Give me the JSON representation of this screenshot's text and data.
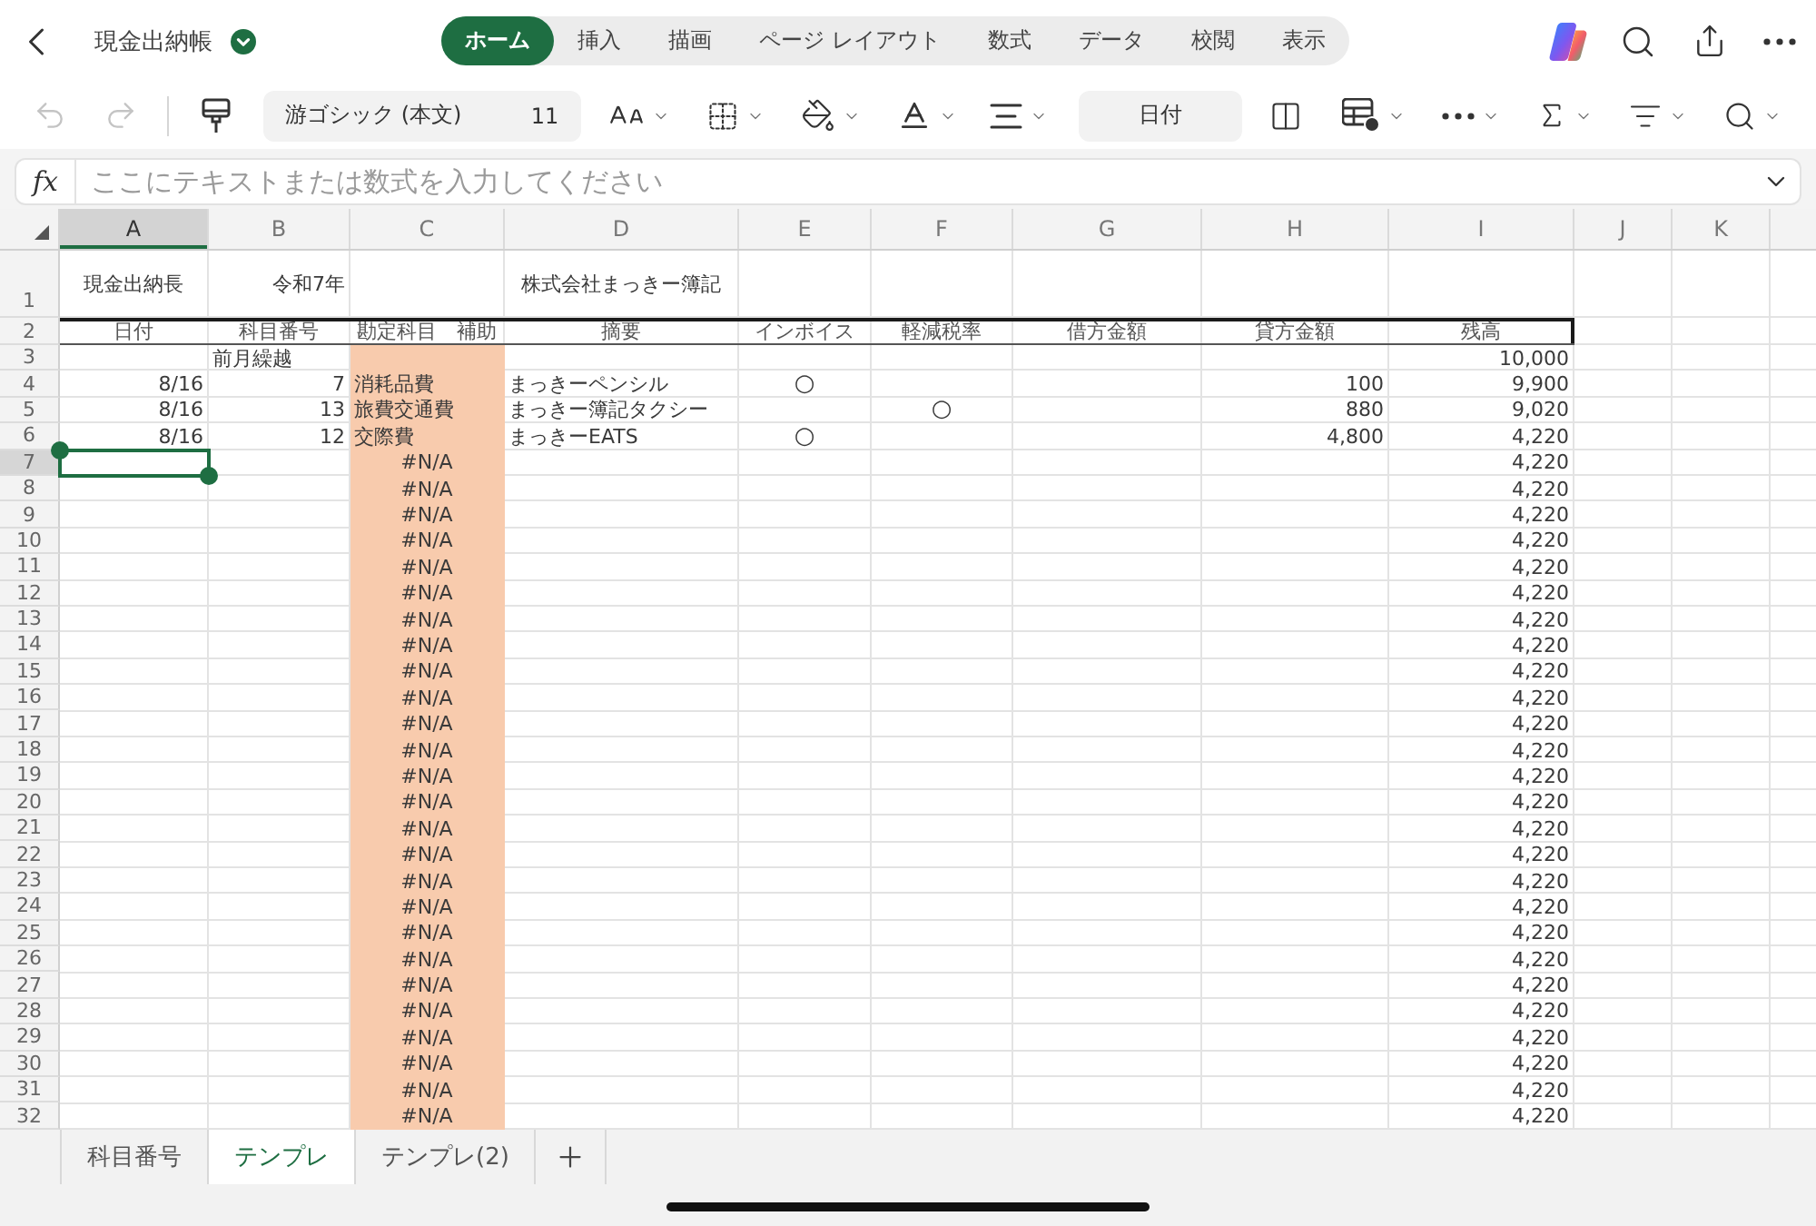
{
  "app_bar": {
    "title": "現金出納帳",
    "tabs": [
      {
        "label": "ホーム",
        "selected": true
      },
      {
        "label": "挿入",
        "selected": false
      },
      {
        "label": "描画",
        "selected": false
      },
      {
        "label": "ページ レイアウト",
        "selected": false
      },
      {
        "label": "数式",
        "selected": false
      },
      {
        "label": "データ",
        "selected": false
      },
      {
        "label": "校閲",
        "selected": false
      },
      {
        "label": "表示",
        "selected": false
      }
    ]
  },
  "toolbar": {
    "history": [
      {
        "kind": "undo",
        "disabled": true
      },
      {
        "kind": "redo",
        "disabled": true
      }
    ],
    "font_name": "游ゴシック (本文)",
    "font_size": "11",
    "number_format": "日付"
  },
  "formula_bar": {
    "label": "fx",
    "placeholder": "ここにテキストまたは数式を入力してください"
  },
  "sheet": {
    "columns": [
      {
        "label": "A",
        "selected": true
      },
      {
        "label": "B",
        "selected": false
      },
      {
        "label": "C",
        "selected": false
      },
      {
        "label": "D",
        "selected": false
      },
      {
        "label": "E",
        "selected": false
      },
      {
        "label": "F",
        "selected": false
      },
      {
        "label": "G",
        "selected": false
      },
      {
        "label": "H",
        "selected": false
      },
      {
        "label": "I",
        "selected": false
      },
      {
        "label": "J",
        "selected": false
      },
      {
        "label": "K",
        "selected": false
      }
    ],
    "rows": [
      {
        "number": "1",
        "kind": "title",
        "selected": false,
        "cells": [
          {
            "text": "現金出納長",
            "kind": "label"
          },
          {
            "text": "令和7年",
            "kind": "date"
          },
          {
            "kind": "blank"
          },
          {
            "text": "株式会社まっきー簿記",
            "kind": "label"
          }
        ]
      },
      {
        "number": "2",
        "kind": "header",
        "selected": false,
        "cells": [
          {
            "text": "日付",
            "kind": "label"
          },
          {
            "text": "科目番号",
            "kind": "label"
          },
          {
            "text": "勘定科目　補助",
            "kind": "label"
          },
          {
            "text": "摘要",
            "kind": "label"
          },
          {
            "text": "インボイス",
            "kind": "label"
          },
          {
            "text": "軽減税率",
            "kind": "label"
          },
          {
            "text": "借方金額",
            "kind": "label"
          },
          {
            "text": "貸方金額",
            "kind": "label"
          },
          {
            "text": "残高",
            "kind": "label"
          }
        ]
      },
      {
        "number": "3",
        "kind": "data",
        "selected": false,
        "cells": [
          {
            "kind": "blank"
          },
          {
            "text": "前月繰越",
            "kind": "text"
          },
          {
            "kind": "blank",
            "color": "#f8cbad"
          },
          {
            "kind": "blank"
          },
          {
            "kind": "blank"
          },
          {
            "kind": "blank"
          },
          {
            "kind": "blank"
          },
          {
            "kind": "blank"
          },
          {
            "text": "10,000",
            "kind": "number"
          }
        ]
      },
      {
        "number": "4",
        "kind": "data",
        "selected": false,
        "cells": [
          {
            "text": "8/16",
            "kind": "date"
          },
          {
            "text": "7",
            "kind": "number"
          },
          {
            "text": "消耗品費",
            "kind": "text",
            "color": "#f8cbad"
          },
          {
            "text": "まっきーペンシル",
            "kind": "text"
          },
          {
            "text": "○",
            "kind": "mark"
          },
          {
            "kind": "blank"
          },
          {
            "kind": "blank"
          },
          {
            "text": "100",
            "kind": "number"
          },
          {
            "text": "9,900",
            "kind": "number"
          }
        ]
      },
      {
        "number": "5",
        "kind": "data",
        "selected": false,
        "cells": [
          {
            "text": "8/16",
            "kind": "date"
          },
          {
            "text": "13",
            "kind": "number"
          },
          {
            "text": "旅費交通費",
            "kind": "text",
            "color": "#f8cbad"
          },
          {
            "text": "まっきー簿記タクシー",
            "kind": "text"
          },
          {
            "kind": "blank"
          },
          {
            "text": "○",
            "kind": "mark"
          },
          {
            "kind": "blank"
          },
          {
            "text": "880",
            "kind": "number"
          },
          {
            "text": "9,020",
            "kind": "number"
          }
        ]
      },
      {
        "number": "6",
        "kind": "data",
        "selected": false,
        "cells": [
          {
            "text": "8/16",
            "kind": "date"
          },
          {
            "text": "12",
            "kind": "number"
          },
          {
            "text": "交際費",
            "kind": "text",
            "color": "#f8cbad"
          },
          {
            "text": "まっきーEATS",
            "kind": "text"
          },
          {
            "text": "○",
            "kind": "mark"
          },
          {
            "kind": "blank"
          },
          {
            "kind": "blank"
          },
          {
            "text": "4,800",
            "kind": "number"
          },
          {
            "text": "4,220",
            "kind": "number"
          }
        ]
      },
      {
        "number": "7",
        "kind": "data",
        "selected": true,
        "cells": [
          {
            "kind": "blank"
          },
          {
            "kind": "blank"
          },
          {
            "text": "#N/A",
            "kind": "error",
            "color": "#f8cbad"
          },
          {
            "kind": "blank"
          },
          {
            "kind": "blank"
          },
          {
            "kind": "blank"
          },
          {
            "kind": "blank"
          },
          {
            "kind": "blank"
          },
          {
            "text": "4,220",
            "kind": "number"
          }
        ]
      },
      {
        "number": "8",
        "kind": "data",
        "selected": false,
        "cells": [
          {
            "kind": "blank"
          },
          {
            "kind": "blank"
          },
          {
            "text": "#N/A",
            "kind": "error",
            "color": "#f8cbad"
          },
          {
            "kind": "blank"
          },
          {
            "kind": "blank"
          },
          {
            "kind": "blank"
          },
          {
            "kind": "blank"
          },
          {
            "kind": "blank"
          },
          {
            "text": "4,220",
            "kind": "number"
          }
        ]
      },
      {
        "number": "9",
        "kind": "data",
        "selected": false,
        "cells": [
          {
            "kind": "blank"
          },
          {
            "kind": "blank"
          },
          {
            "text": "#N/A",
            "kind": "error",
            "color": "#f8cbad"
          },
          {
            "kind": "blank"
          },
          {
            "kind": "blank"
          },
          {
            "kind": "blank"
          },
          {
            "kind": "blank"
          },
          {
            "kind": "blank"
          },
          {
            "text": "4,220",
            "kind": "number"
          }
        ]
      },
      {
        "number": "10",
        "kind": "data",
        "selected": false,
        "cells": [
          {
            "kind": "blank"
          },
          {
            "kind": "blank"
          },
          {
            "text": "#N/A",
            "kind": "error",
            "color": "#f8cbad"
          },
          {
            "kind": "blank"
          },
          {
            "kind": "blank"
          },
          {
            "kind": "blank"
          },
          {
            "kind": "blank"
          },
          {
            "kind": "blank"
          },
          {
            "text": "4,220",
            "kind": "number"
          }
        ]
      },
      {
        "number": "11",
        "kind": "data",
        "selected": false,
        "cells": [
          {
            "kind": "blank"
          },
          {
            "kind": "blank"
          },
          {
            "text": "#N/A",
            "kind": "error",
            "color": "#f8cbad"
          },
          {
            "kind": "blank"
          },
          {
            "kind": "blank"
          },
          {
            "kind": "blank"
          },
          {
            "kind": "blank"
          },
          {
            "kind": "blank"
          },
          {
            "text": "4,220",
            "kind": "number"
          }
        ]
      },
      {
        "number": "12",
        "kind": "data",
        "selected": false,
        "cells": [
          {
            "kind": "blank"
          },
          {
            "kind": "blank"
          },
          {
            "text": "#N/A",
            "kind": "error",
            "color": "#f8cbad"
          },
          {
            "kind": "blank"
          },
          {
            "kind": "blank"
          },
          {
            "kind": "blank"
          },
          {
            "kind": "blank"
          },
          {
            "kind": "blank"
          },
          {
            "text": "4,220",
            "kind": "number"
          }
        ]
      },
      {
        "number": "13",
        "kind": "data",
        "selected": false,
        "cells": [
          {
            "kind": "blank"
          },
          {
            "kind": "blank"
          },
          {
            "text": "#N/A",
            "kind": "error",
            "color": "#f8cbad"
          },
          {
            "kind": "blank"
          },
          {
            "kind": "blank"
          },
          {
            "kind": "blank"
          },
          {
            "kind": "blank"
          },
          {
            "kind": "blank"
          },
          {
            "text": "4,220",
            "kind": "number"
          }
        ]
      },
      {
        "number": "14",
        "kind": "data",
        "selected": false,
        "cells": [
          {
            "kind": "blank"
          },
          {
            "kind": "blank"
          },
          {
            "text": "#N/A",
            "kind": "error",
            "color": "#f8cbad"
          },
          {
            "kind": "blank"
          },
          {
            "kind": "blank"
          },
          {
            "kind": "blank"
          },
          {
            "kind": "blank"
          },
          {
            "kind": "blank"
          },
          {
            "text": "4,220",
            "kind": "number"
          }
        ]
      },
      {
        "number": "15",
        "kind": "data",
        "selected": false,
        "cells": [
          {
            "kind": "blank"
          },
          {
            "kind": "blank"
          },
          {
            "text": "#N/A",
            "kind": "error",
            "color": "#f8cbad"
          },
          {
            "kind": "blank"
          },
          {
            "kind": "blank"
          },
          {
            "kind": "blank"
          },
          {
            "kind": "blank"
          },
          {
            "kind": "blank"
          },
          {
            "text": "4,220",
            "kind": "number"
          }
        ]
      },
      {
        "number": "16",
        "kind": "data",
        "selected": false,
        "cells": [
          {
            "kind": "blank"
          },
          {
            "kind": "blank"
          },
          {
            "text": "#N/A",
            "kind": "error",
            "color": "#f8cbad"
          },
          {
            "kind": "blank"
          },
          {
            "kind": "blank"
          },
          {
            "kind": "blank"
          },
          {
            "kind": "blank"
          },
          {
            "kind": "blank"
          },
          {
            "text": "4,220",
            "kind": "number"
          }
        ]
      },
      {
        "number": "17",
        "kind": "data",
        "selected": false,
        "cells": [
          {
            "kind": "blank"
          },
          {
            "kind": "blank"
          },
          {
            "text": "#N/A",
            "kind": "error",
            "color": "#f8cbad"
          },
          {
            "kind": "blank"
          },
          {
            "kind": "blank"
          },
          {
            "kind": "blank"
          },
          {
            "kind": "blank"
          },
          {
            "kind": "blank"
          },
          {
            "text": "4,220",
            "kind": "number"
          }
        ]
      },
      {
        "number": "18",
        "kind": "data",
        "selected": false,
        "cells": [
          {
            "kind": "blank"
          },
          {
            "kind": "blank"
          },
          {
            "text": "#N/A",
            "kind": "error",
            "color": "#f8cbad"
          },
          {
            "kind": "blank"
          },
          {
            "kind": "blank"
          },
          {
            "kind": "blank"
          },
          {
            "kind": "blank"
          },
          {
            "kind": "blank"
          },
          {
            "text": "4,220",
            "kind": "number"
          }
        ]
      },
      {
        "number": "19",
        "kind": "data",
        "selected": false,
        "cells": [
          {
            "kind": "blank"
          },
          {
            "kind": "blank"
          },
          {
            "text": "#N/A",
            "kind": "error",
            "color": "#f8cbad"
          },
          {
            "kind": "blank"
          },
          {
            "kind": "blank"
          },
          {
            "kind": "blank"
          },
          {
            "kind": "blank"
          },
          {
            "kind": "blank"
          },
          {
            "text": "4,220",
            "kind": "number"
          }
        ]
      },
      {
        "number": "20",
        "kind": "data",
        "selected": false,
        "cells": [
          {
            "kind": "blank"
          },
          {
            "kind": "blank"
          },
          {
            "text": "#N/A",
            "kind": "error",
            "color": "#f8cbad"
          },
          {
            "kind": "blank"
          },
          {
            "kind": "blank"
          },
          {
            "kind": "blank"
          },
          {
            "kind": "blank"
          },
          {
            "kind": "blank"
          },
          {
            "text": "4,220",
            "kind": "number"
          }
        ]
      },
      {
        "number": "21",
        "kind": "data",
        "selected": false,
        "cells": [
          {
            "kind": "blank"
          },
          {
            "kind": "blank"
          },
          {
            "text": "#N/A",
            "kind": "error",
            "color": "#f8cbad"
          },
          {
            "kind": "blank"
          },
          {
            "kind": "blank"
          },
          {
            "kind": "blank"
          },
          {
            "kind": "blank"
          },
          {
            "kind": "blank"
          },
          {
            "text": "4,220",
            "kind": "number"
          }
        ]
      },
      {
        "number": "22",
        "kind": "data",
        "selected": false,
        "cells": [
          {
            "kind": "blank"
          },
          {
            "kind": "blank"
          },
          {
            "text": "#N/A",
            "kind": "error",
            "color": "#f8cbad"
          },
          {
            "kind": "blank"
          },
          {
            "kind": "blank"
          },
          {
            "kind": "blank"
          },
          {
            "kind": "blank"
          },
          {
            "kind": "blank"
          },
          {
            "text": "4,220",
            "kind": "number"
          }
        ]
      },
      {
        "number": "23",
        "kind": "data",
        "selected": false,
        "cells": [
          {
            "kind": "blank"
          },
          {
            "kind": "blank"
          },
          {
            "text": "#N/A",
            "kind": "error",
            "color": "#f8cbad"
          },
          {
            "kind": "blank"
          },
          {
            "kind": "blank"
          },
          {
            "kind": "blank"
          },
          {
            "kind": "blank"
          },
          {
            "kind": "blank"
          },
          {
            "text": "4,220",
            "kind": "number"
          }
        ]
      },
      {
        "number": "24",
        "kind": "data",
        "selected": false,
        "cells": [
          {
            "kind": "blank"
          },
          {
            "kind": "blank"
          },
          {
            "text": "#N/A",
            "kind": "error",
            "color": "#f8cbad"
          },
          {
            "kind": "blank"
          },
          {
            "kind": "blank"
          },
          {
            "kind": "blank"
          },
          {
            "kind": "blank"
          },
          {
            "kind": "blank"
          },
          {
            "text": "4,220",
            "kind": "number"
          }
        ]
      },
      {
        "number": "25",
        "kind": "data",
        "selected": false,
        "cells": [
          {
            "kind": "blank"
          },
          {
            "kind": "blank"
          },
          {
            "text": "#N/A",
            "kind": "error",
            "color": "#f8cbad"
          },
          {
            "kind": "blank"
          },
          {
            "kind": "blank"
          },
          {
            "kind": "blank"
          },
          {
            "kind": "blank"
          },
          {
            "kind": "blank"
          },
          {
            "text": "4,220",
            "kind": "number"
          }
        ]
      },
      {
        "number": "26",
        "kind": "data",
        "selected": false,
        "cells": [
          {
            "kind": "blank"
          },
          {
            "kind": "blank"
          },
          {
            "text": "#N/A",
            "kind": "error",
            "color": "#f8cbad"
          },
          {
            "kind": "blank"
          },
          {
            "kind": "blank"
          },
          {
            "kind": "blank"
          },
          {
            "kind": "blank"
          },
          {
            "kind": "blank"
          },
          {
            "text": "4,220",
            "kind": "number"
          }
        ]
      },
      {
        "number": "27",
        "kind": "data",
        "selected": false,
        "cells": [
          {
            "kind": "blank"
          },
          {
            "kind": "blank"
          },
          {
            "text": "#N/A",
            "kind": "error",
            "color": "#f8cbad"
          },
          {
            "kind": "blank"
          },
          {
            "kind": "blank"
          },
          {
            "kind": "blank"
          },
          {
            "kind": "blank"
          },
          {
            "kind": "blank"
          },
          {
            "text": "4,220",
            "kind": "number"
          }
        ]
      },
      {
        "number": "28",
        "kind": "data",
        "selected": false,
        "cells": [
          {
            "kind": "blank"
          },
          {
            "kind": "blank"
          },
          {
            "text": "#N/A",
            "kind": "error",
            "color": "#f8cbad"
          },
          {
            "kind": "blank"
          },
          {
            "kind": "blank"
          },
          {
            "kind": "blank"
          },
          {
            "kind": "blank"
          },
          {
            "kind": "blank"
          },
          {
            "text": "4,220",
            "kind": "number"
          }
        ]
      },
      {
        "number": "29",
        "kind": "data",
        "selected": false,
        "cells": [
          {
            "kind": "blank"
          },
          {
            "kind": "blank"
          },
          {
            "text": "#N/A",
            "kind": "error",
            "color": "#f8cbad"
          },
          {
            "kind": "blank"
          },
          {
            "kind": "blank"
          },
          {
            "kind": "blank"
          },
          {
            "kind": "blank"
          },
          {
            "kind": "blank"
          },
          {
            "text": "4,220",
            "kind": "number"
          }
        ]
      },
      {
        "number": "30",
        "kind": "data",
        "selected": false,
        "cells": [
          {
            "kind": "blank"
          },
          {
            "kind": "blank"
          },
          {
            "text": "#N/A",
            "kind": "error",
            "color": "#f8cbad"
          },
          {
            "kind": "blank"
          },
          {
            "kind": "blank"
          },
          {
            "kind": "blank"
          },
          {
            "kind": "blank"
          },
          {
            "kind": "blank"
          },
          {
            "text": "4,220",
            "kind": "number"
          }
        ]
      },
      {
        "number": "31",
        "kind": "data",
        "selected": false,
        "cells": [
          {
            "kind": "blank"
          },
          {
            "kind": "blank"
          },
          {
            "text": "#N/A",
            "kind": "error",
            "color": "#f8cbad"
          },
          {
            "kind": "blank"
          },
          {
            "kind": "blank"
          },
          {
            "kind": "blank"
          },
          {
            "kind": "blank"
          },
          {
            "kind": "blank"
          },
          {
            "text": "4,220",
            "kind": "number"
          }
        ]
      },
      {
        "number": "32",
        "kind": "data",
        "selected": false,
        "cells": [
          {
            "kind": "blank"
          },
          {
            "kind": "blank"
          },
          {
            "text": "#N/A",
            "kind": "error",
            "color": "#f8cbad"
          },
          {
            "kind": "blank"
          },
          {
            "kind": "blank"
          },
          {
            "kind": "blank"
          },
          {
            "kind": "blank"
          },
          {
            "kind": "blank"
          },
          {
            "text": "4,220",
            "kind": "number"
          }
        ]
      }
    ]
  },
  "sheet_tabs": [
    {
      "label": "科目番号",
      "selected": false
    },
    {
      "label": "テンプレ",
      "selected": true
    },
    {
      "label": "テンプレ(2)",
      "selected": false
    }
  ]
}
